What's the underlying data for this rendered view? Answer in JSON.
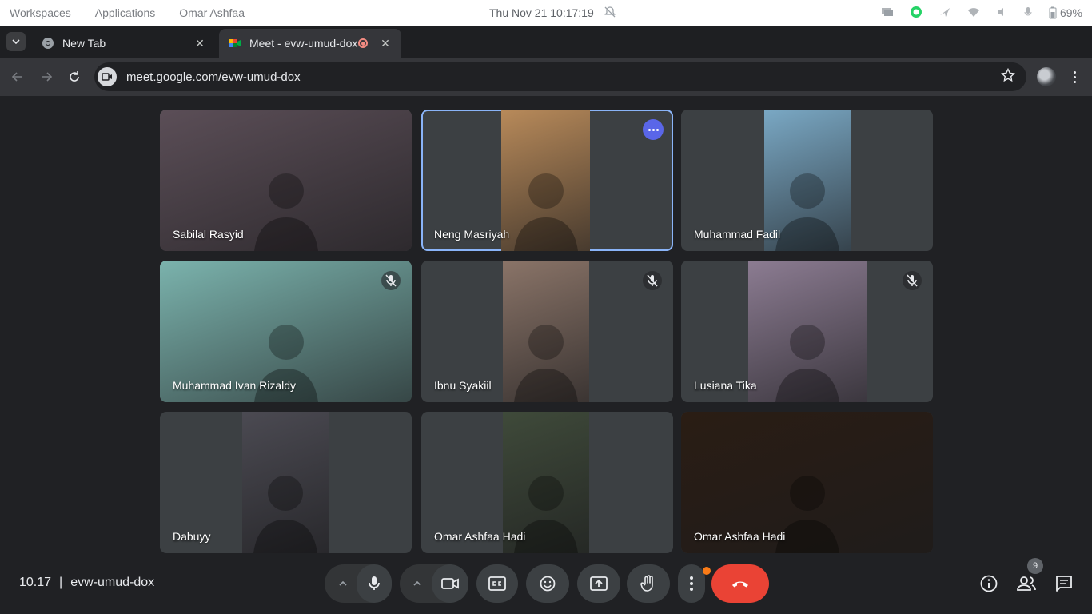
{
  "os_bar": {
    "workspaces": "Workspaces",
    "applications": "Applications",
    "user": "Omar Ashfaa",
    "datetime": "Thu Nov 21  10:17:19",
    "battery": "69%"
  },
  "browser": {
    "tabs": [
      {
        "title": "New Tab",
        "close": "✕"
      },
      {
        "title": "Meet - evw-umud-dox",
        "close": "✕"
      }
    ],
    "new_tab": "+",
    "url": "meet.google.com/evw-umud-dox"
  },
  "participants": [
    {
      "name": "Sabilal Rasyid",
      "muted": false,
      "color": "#5b4e57"
    },
    {
      "name": "Neng Masriyah",
      "muted": false,
      "color": "#b88a5a",
      "active": true
    },
    {
      "name": "Muhammad Fadil",
      "muted": false,
      "color": "#7aa8c4"
    },
    {
      "name": "Muhammad Ivan Rizaldy",
      "muted": true,
      "color": "#7bb3ad"
    },
    {
      "name": "Ibnu Syakiil",
      "muted": true,
      "color": "#8a7468"
    },
    {
      "name": "Lusiana Tika",
      "muted": true,
      "color": "#8c7c92"
    },
    {
      "name": "Dabuyy",
      "muted": false,
      "color": "#4b4a52"
    },
    {
      "name": "Omar Ashfaa Hadi",
      "muted": false,
      "color": "#3f4a3a"
    },
    {
      "name": "Omar Ashfaa Hadi",
      "muted": false,
      "color": "#2a1d14"
    }
  ],
  "meeting": {
    "time": "10.17",
    "separator": "|",
    "code": "evw-umud-dox",
    "participant_count": "9"
  },
  "colors": {
    "end_call": "#ea4335",
    "active_outline": "#8ab4f8",
    "notification": "#fa7b17"
  }
}
